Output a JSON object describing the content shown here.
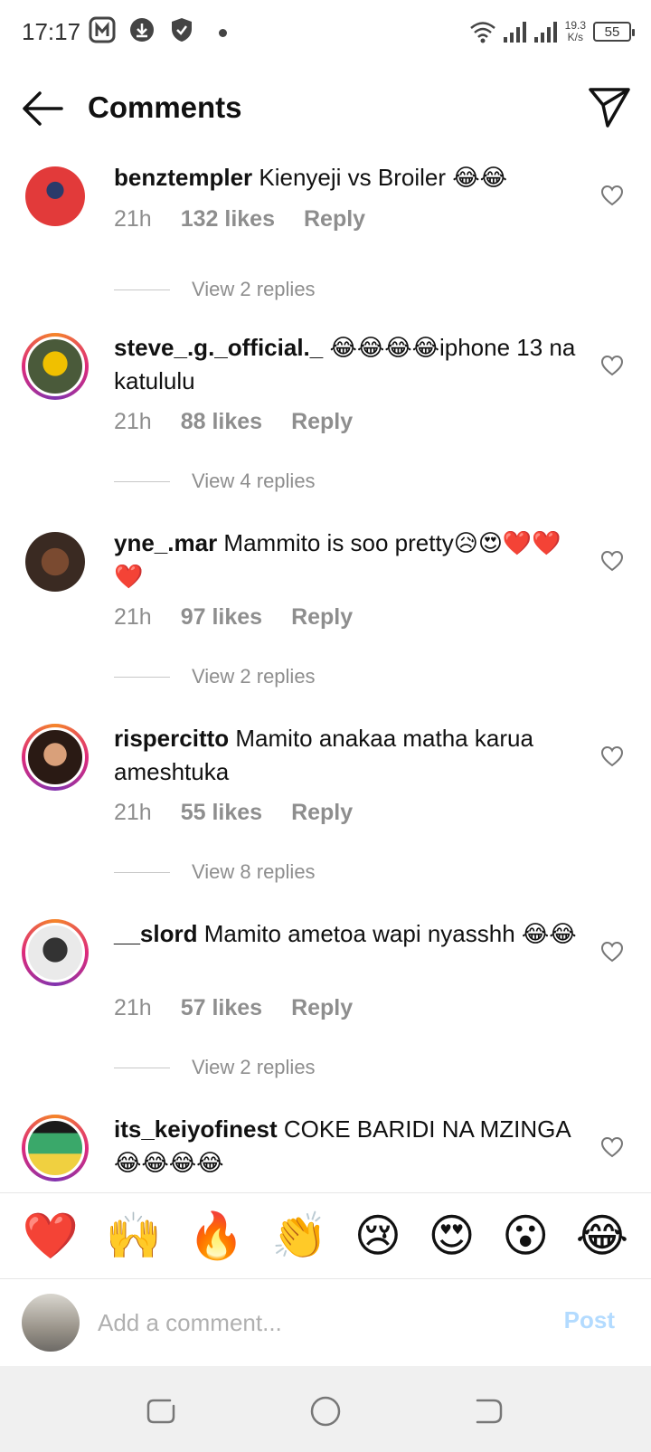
{
  "status_bar": {
    "time": "17:17",
    "net_speed_value": "19.3",
    "net_speed_unit": "K/s",
    "battery": "55"
  },
  "header": {
    "title": "Comments"
  },
  "comments": [
    {
      "user": "benztempler",
      "text": "Kienyeji vs Broiler 😂😂",
      "time": "21h",
      "likes": "132 likes",
      "reply": "Reply",
      "view_replies": "View 2 replies"
    },
    {
      "user": "steve_.g._official._",
      "text": "😂😂😂😂iphone 13 na katululu",
      "time": "21h",
      "likes": "88 likes",
      "reply": "Reply",
      "view_replies": "View 4 replies"
    },
    {
      "user": "yne_.mar",
      "text": "Mammito is soo pretty😥😍❤️❤️❤️",
      "time": "21h",
      "likes": "97 likes",
      "reply": "Reply",
      "view_replies": "View 2 replies"
    },
    {
      "user": "rispercitto",
      "text": "Mamito anakaa matha karua ameshtuka",
      "time": "21h",
      "likes": "55 likes",
      "reply": "Reply",
      "view_replies": "View 8 replies"
    },
    {
      "user": "__slord",
      "text": "Mamito ametoa wapi nyasshh 😂😂",
      "time": "21h",
      "likes": "57 likes",
      "reply": "Reply",
      "view_replies": "View 2 replies"
    },
    {
      "user": "its_keiyofinest",
      "text": "COKE BARIDI NA MZINGA😂😂😂😂",
      "time": "",
      "likes": "",
      "reply": "",
      "view_replies": ""
    }
  ],
  "emoji_bar": [
    "❤️",
    "🙌",
    "🔥",
    "👏",
    "😢",
    "😍",
    "😮",
    "😂"
  ],
  "composer": {
    "placeholder": "Add a comment...",
    "post_label": "Post"
  },
  "icons": {
    "back": "arrow-left-icon",
    "send": "paper-plane-icon",
    "like": "heart-outline-icon"
  }
}
